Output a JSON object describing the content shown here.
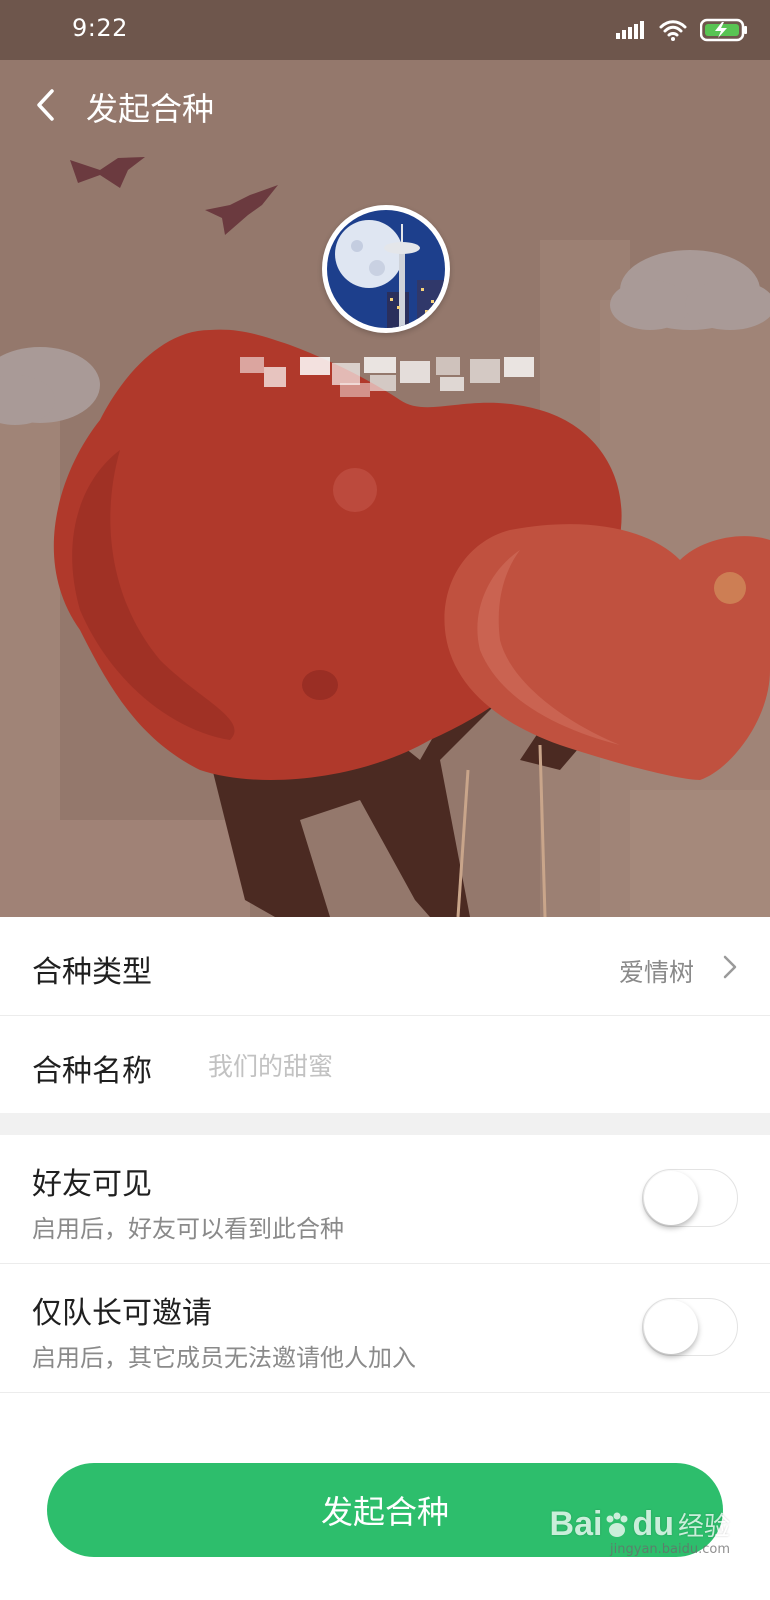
{
  "status": {
    "time": "9:22"
  },
  "header": {
    "title": "发起合种"
  },
  "form": {
    "type": {
      "label": "合种类型",
      "value": "爱情树"
    },
    "name": {
      "label": "合种名称",
      "placeholder": "我们的甜蜜"
    }
  },
  "options": [
    {
      "title": "好友可见",
      "desc": "启用后，好友可以看到此合种",
      "enabled": false
    },
    {
      "title": "仅队长可邀请",
      "desc": "启用后，其它成员无法邀请他人加入",
      "enabled": false
    }
  ],
  "submit": {
    "label": "发起合种"
  },
  "watermark": {
    "brand": "Bai",
    "brand2": "du",
    "sub": "经验",
    "url": "jingyan.baidu.com"
  },
  "colors": {
    "accent": "#2dbe6c",
    "hero_bg": "#8a6f66",
    "heart": "#b0392b"
  }
}
